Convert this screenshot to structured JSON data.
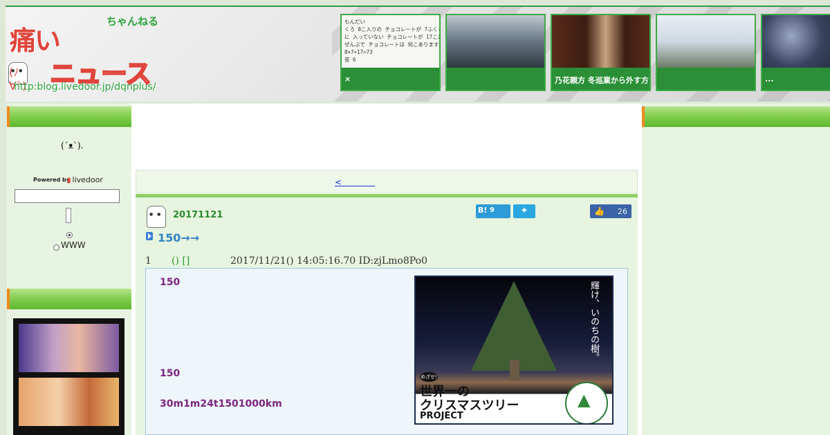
{
  "header": {
    "logo_big": "痛い",
    "logo_small": "ちゃんねる",
    "logo_face": "(ﾉ∀`)",
    "logo_news": "ニュース",
    "logo_url": "http:blog.livedoor.jp/dqnplus/",
    "thumbs": [
      {
        "caption": "×",
        "note": "もんだい\nくろ 8こ入りの チョコレートが 7ふくろと\nに 入っていない チョコレートが 17こあり\nぜんぶで チョコレートは 何こありますか。\n8×7+17=73\n答 6"
      },
      {
        "caption": ""
      },
      {
        "caption": "乃花親方 冬巡業から外す方"
      },
      {
        "caption": ""
      },
      {
        "caption": "..."
      }
    ]
  },
  "sidebar": {
    "icon_text": "(´ᴥ`).",
    "powered_by": "Powered by",
    "livedoor": "livedoor",
    "search_value": "",
    "radio_www": "WWW"
  },
  "nav": {
    "prev_link": "<　　　　"
  },
  "post": {
    "date": "20171121",
    "title": "150→→",
    "hatena_label": "B!",
    "hatena_count": "9",
    "twitter_icon": "bird-icon",
    "fb_icon": "thumbs-up-icon",
    "fb_count": "26",
    "res_num": "1",
    "res_name": "() []",
    "res_meta": "2017/11/21() 14:05:16.70 ID:zjLmo8Po0",
    "lines": [
      "150",
      "150",
      "30m1m24t1501000km"
    ],
    "image": {
      "vertical_text": "輝け、いのちの樹。",
      "badge": "めざせ!",
      "line1": "世界一の",
      "line2": "クリスマスツリー",
      "line3": "PROJECT"
    }
  },
  "colors": {
    "accent_green": "#2d9a3c",
    "sidebar_bg": "#e8f4e2",
    "bar_orange": "#f08a1f",
    "title_blue": "#2f82c4",
    "body_purple": "#7b2580"
  }
}
